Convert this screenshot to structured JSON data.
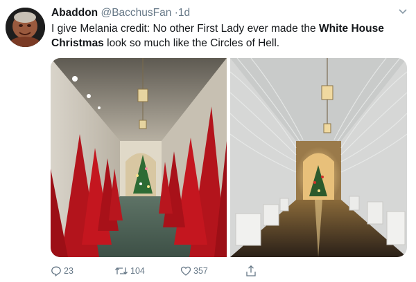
{
  "tweet": {
    "display_name": "Abaddon",
    "handle": "@BacchusFan",
    "separator": "·",
    "time": "1d",
    "text_part1": "I give Melania credit: No other First Lady ever made the ",
    "text_bold1": "White House Christmas",
    "text_part2": " look so much like the Circles of Hell."
  },
  "media": {
    "left_photo": "red-trees-corridor-photo",
    "right_photo": "white-branches-corridor-photo"
  },
  "actions": {
    "reply_count": "23",
    "retweet_count": "104",
    "like_count": "357"
  },
  "icons": {
    "reply": "reply-icon",
    "retweet": "retweet-icon",
    "like": "heart-icon",
    "share": "share-icon",
    "menu": "chevron-down-icon"
  },
  "colors": {
    "text": "#14171a",
    "secondary": "#657786"
  }
}
